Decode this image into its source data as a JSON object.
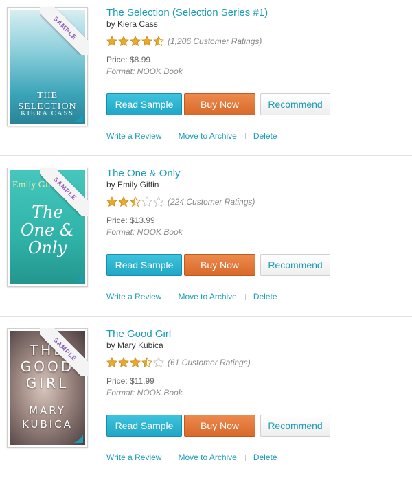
{
  "books": [
    {
      "title": "The Selection (Selection Series #1)",
      "author": "by Kiera Cass",
      "rating": 4.5,
      "ratings_text": "(1,206 Customer Ratings)",
      "price": "Price: $8.99",
      "format": "Format: NOOK Book",
      "cover": {
        "top_text": "THE SELECTION",
        "bottom_text": "KIERA CASS",
        "colors": [
          "#bfe3ea",
          "#5bb7c8",
          "#2f8ea3"
        ]
      },
      "sample_label": "SAMPLE",
      "buttons": {
        "read": "Read Sample",
        "buy": "Buy Now",
        "recommend": "Recommend"
      },
      "links": {
        "review": "Write a Review",
        "archive": "Move to Archive",
        "delete": "Delete"
      }
    },
    {
      "title": "The One & Only",
      "author": "by Emily Giffin",
      "rating": 2.5,
      "ratings_text": "(224 Customer Ratings)",
      "price": "Price: $13.99",
      "format": "Format: NOOK Book",
      "cover": {
        "top_text": "Emily Giffin",
        "bottom_text": "The One & Only",
        "colors": [
          "#3fc2b8",
          "#27a9a0",
          "#1e8f88"
        ]
      },
      "sample_label": "SAMPLE",
      "buttons": {
        "read": "Read Sample",
        "buy": "Buy Now",
        "recommend": "Recommend"
      },
      "links": {
        "review": "Write a Review",
        "archive": "Move to Archive",
        "delete": "Delete"
      }
    },
    {
      "title": "The Good Girl",
      "author": "by Mary Kubica",
      "rating": 3.5,
      "ratings_text": "(61 Customer Ratings)",
      "price": "Price: $11.99",
      "format": "Format: NOOK Book",
      "cover": {
        "top_text": "THE GOOD GIRL",
        "bottom_text": "MARY KUBICA",
        "colors": [
          "#c9b8b0",
          "#8c7670",
          "#4b3c3c"
        ]
      },
      "sample_label": "SAMPLE",
      "buttons": {
        "read": "Read Sample",
        "buy": "Buy Now",
        "recommend": "Recommend"
      },
      "links": {
        "review": "Write a Review",
        "archive": "Move to Archive",
        "delete": "Delete"
      }
    }
  ],
  "colors": {
    "link": "#1a9bb6",
    "star": "#e9a82e",
    "star_empty": "#d9d9d9"
  }
}
